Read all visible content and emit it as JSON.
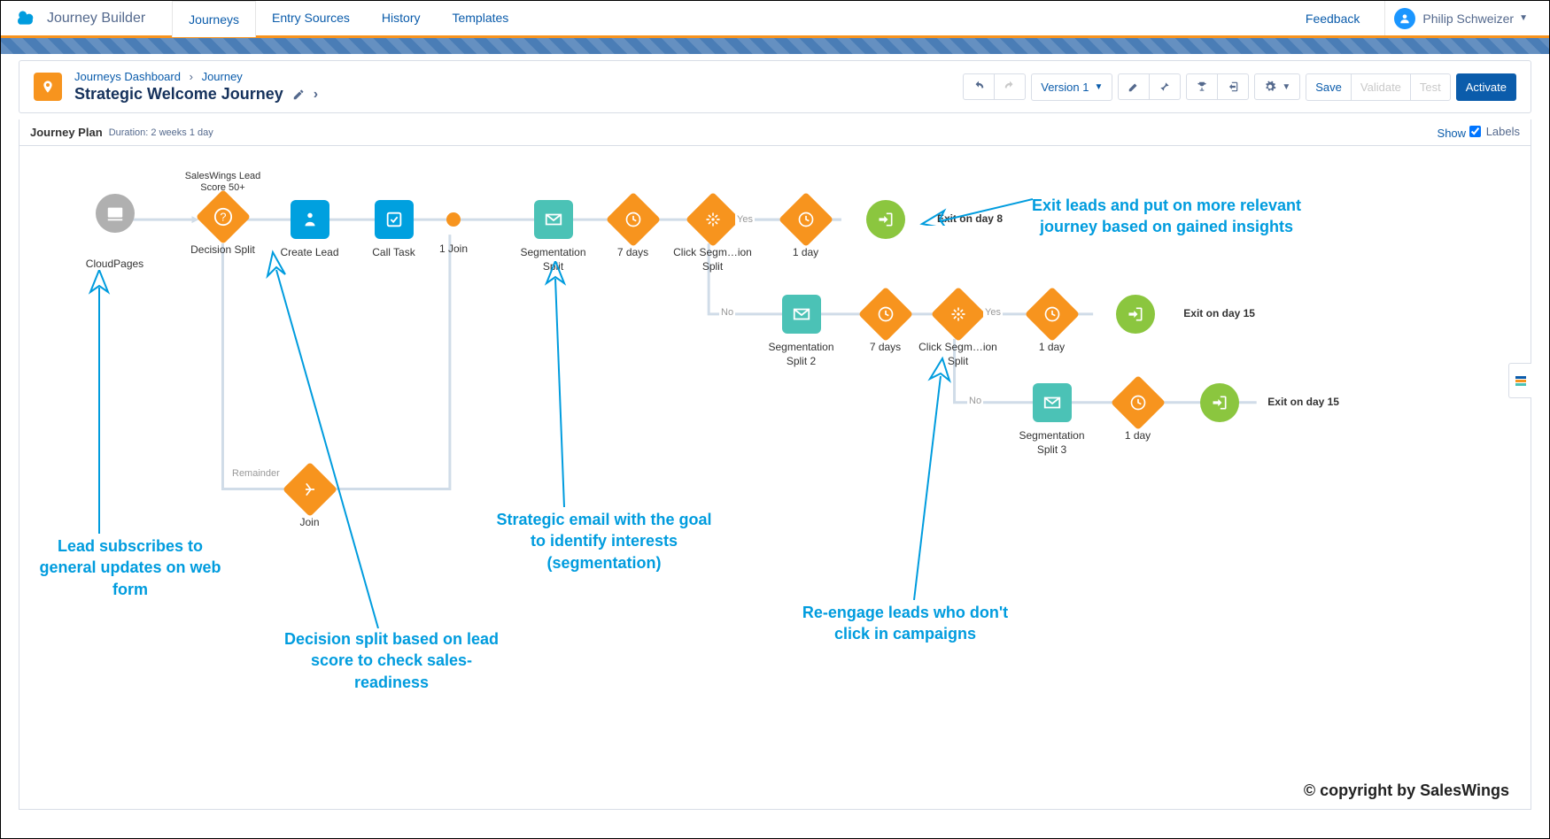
{
  "nav": {
    "appTitle": "Journey Builder",
    "tabs": [
      "Journeys",
      "Entry Sources",
      "History",
      "Templates"
    ],
    "feedback": "Feedback",
    "userName": "Philip Schweizer"
  },
  "header": {
    "breadcrumb1": "Journeys Dashboard",
    "breadcrumb2": "Journey",
    "title": "Strategic Welcome Journey",
    "versionBtn": "Version 1",
    "save": "Save",
    "validate": "Validate",
    "test": "Test",
    "activate": "Activate"
  },
  "planBar": {
    "label": "Journey Plan",
    "durationLabel": "Duration:",
    "duration": "2 weeks 1 day",
    "show": "Show",
    "labels": "Labels"
  },
  "nodes": {
    "cloudpages": "CloudPages",
    "decisionSplit": "Decision Split",
    "decisionSplitTop": "SalesWings Lead Score 50+",
    "remainder": "Remainder",
    "createLead": "Create Lead",
    "callTask": "Call Task",
    "join1": "1 Join",
    "join": "Join",
    "segSplit": "Segmentation Split",
    "days7a": "7 days",
    "clickSeg": "Click Segm…ion Split",
    "day1a": "1 day",
    "exit8": "Exit on day 8",
    "segSplit2": "Segmentation Split 2",
    "days7b": "7 days",
    "clickSeg2": "Click Segm…ion Split",
    "day1b": "1 day",
    "exit15a": "Exit on day 15",
    "segSplit3": "Segmentation Split 3",
    "day1c": "1 day",
    "exit15b": "Exit on day 15",
    "yes": "Yes",
    "no": "No"
  },
  "annotations": {
    "a1": "Lead subscribes to general updates on web form",
    "a2": "Decision split based on lead score to check sales-readiness",
    "a3": "Strategic email with the goal to identify interests (segmentation)",
    "a4": "Re-engage leads who don't click in campaigns",
    "a5": "Exit leads and put on more relevant journey based on gained insights"
  },
  "copyright": "© copyright by SalesWings"
}
